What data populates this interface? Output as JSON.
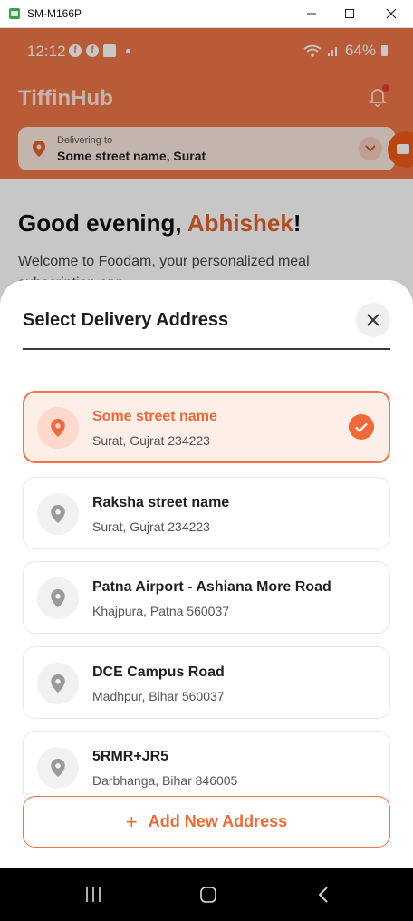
{
  "window": {
    "title": "SM-M166P"
  },
  "statusbar": {
    "time": "12:12",
    "battery": "64%"
  },
  "app": {
    "brand": "TiffinHub",
    "delivering_label": "Delivering to",
    "delivering_value": "Some street name, Surat",
    "greeting_prefix": "Good evening, ",
    "greeting_name": "Abhishek",
    "greeting_suffix": "!",
    "welcome": "Welcome to Foodam, your personalized meal subscription app"
  },
  "sheet": {
    "title": "Select Delivery Address",
    "addresses": [
      {
        "title": "Some street name",
        "subtitle": "Surat, Gujrat 234223",
        "selected": true
      },
      {
        "title": "Raksha street name",
        "subtitle": "Surat, Gujrat 234223",
        "selected": false
      },
      {
        "title": "Patna Airport - Ashiana More Road",
        "subtitle": "Khajpura, Patna 560037",
        "selected": false
      },
      {
        "title": "DCE Campus Road",
        "subtitle": "Madhpur, Bihar 560037",
        "selected": false
      },
      {
        "title": "5RMR+JR5",
        "subtitle": "Darbhanga, Bihar 846005",
        "selected": false
      }
    ],
    "add_button": "Add New Address"
  },
  "colors": {
    "accent": "#ef7548",
    "accent_dark": "#e8693a",
    "header": "#ef7548"
  },
  "icons": {
    "pin": "location-pin-icon",
    "check": "check-icon",
    "close": "close-icon",
    "plus": "plus-icon",
    "bell": "bell-icon",
    "chevron": "chevron-down-icon"
  }
}
